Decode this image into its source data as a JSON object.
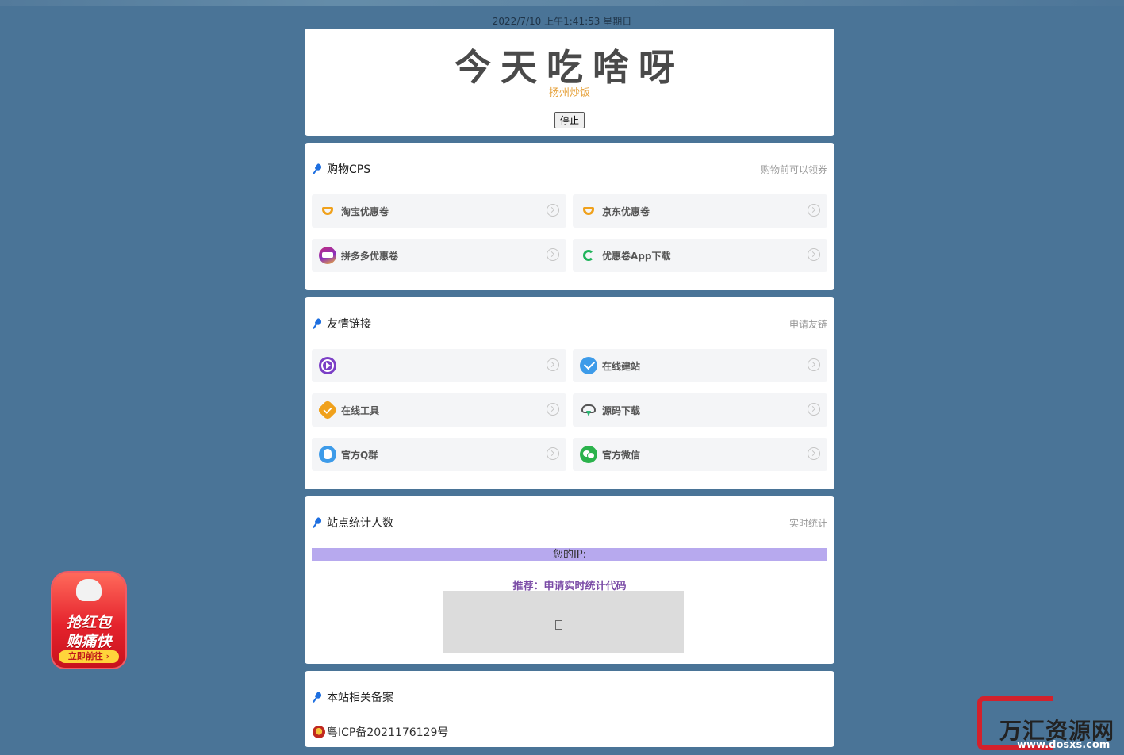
{
  "datetime": "2022/7/10 上午1:41:53 星期日",
  "hero": {
    "title": "今天吃啥呀",
    "food": "扬州炒饭",
    "stop_button": "停止"
  },
  "shopping": {
    "title": "购物CPS",
    "hint": "购物前可以领券",
    "items": [
      {
        "label": "淘宝优惠卷",
        "icon": "coupon-cup-icon"
      },
      {
        "label": "京东优惠卷",
        "icon": "coupon-cup-icon"
      },
      {
        "label": "拼多多优惠卷",
        "icon": "pinduoduo-icon"
      },
      {
        "label": "优惠卷App下载",
        "icon": "app-c-icon"
      }
    ]
  },
  "links": {
    "title": "友情链接",
    "hint": "申请友链",
    "items": [
      {
        "label": "",
        "icon": "play-circle-icon"
      },
      {
        "label": "在线建站",
        "icon": "check-circle-icon"
      },
      {
        "label": "在线工具",
        "icon": "badge-check-icon"
      },
      {
        "label": "源码下载",
        "icon": "cloud-download-icon"
      },
      {
        "label": "官方Q群",
        "icon": "qq-icon"
      },
      {
        "label": "官方微信",
        "icon": "wechat-icon"
      }
    ]
  },
  "stats": {
    "title": "站点统计人数",
    "hint": "实时统计",
    "ip_label": "您的IP:",
    "recommend": "推荐：申请实时统计代码"
  },
  "icp": {
    "title": "本站相关备案",
    "number": "粤ICP备2021176129号"
  },
  "promo": {
    "line1": "抢红包",
    "line2": "购痛快",
    "button": "立即前往 ›"
  },
  "watermark": {
    "name": "万汇资源网",
    "url": "www.dosxs.com"
  },
  "colors": {
    "background": "#4a7497",
    "accent_blue": "#1e6fe0",
    "food_orange": "#e6a23c",
    "ip_bar": "#b7a9ee",
    "recommend_purple": "#7a4ba6"
  }
}
